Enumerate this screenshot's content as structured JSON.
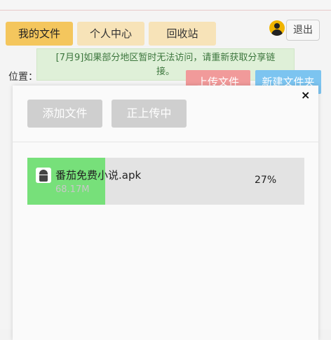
{
  "nav": {
    "tabs": [
      {
        "label": "我的文件"
      },
      {
        "label": "个人中心"
      },
      {
        "label": "回收站"
      }
    ],
    "logout_label": "退出"
  },
  "notice": {
    "line1": "[7月9]如果部分地区暂时无法访问，请重新获取分享链",
    "line2": "接。"
  },
  "location_label": "位置：",
  "actions": {
    "upload_label": "上传文件",
    "new_folder_label": "新建文件夹"
  },
  "upload_modal": {
    "close_label": "×",
    "add_file_label": "添加文件",
    "uploading_label": "正上传中",
    "file": {
      "name": "番茄免费小说.apk",
      "size": "68.17M",
      "progress_text": "27%",
      "progress_fraction": 0.28
    }
  },
  "colors": {
    "tab_active": "#f4c65d",
    "tab_inactive": "#f7e3b8",
    "notice_bg": "#dff0d8",
    "upload_btn": "#f19a9a",
    "new_folder_btn": "#7cc4f0",
    "progress": "#77e07a"
  },
  "icons": {
    "avatar": "user-avatar-icon",
    "file": "android-apk-icon",
    "close": "close-icon"
  }
}
